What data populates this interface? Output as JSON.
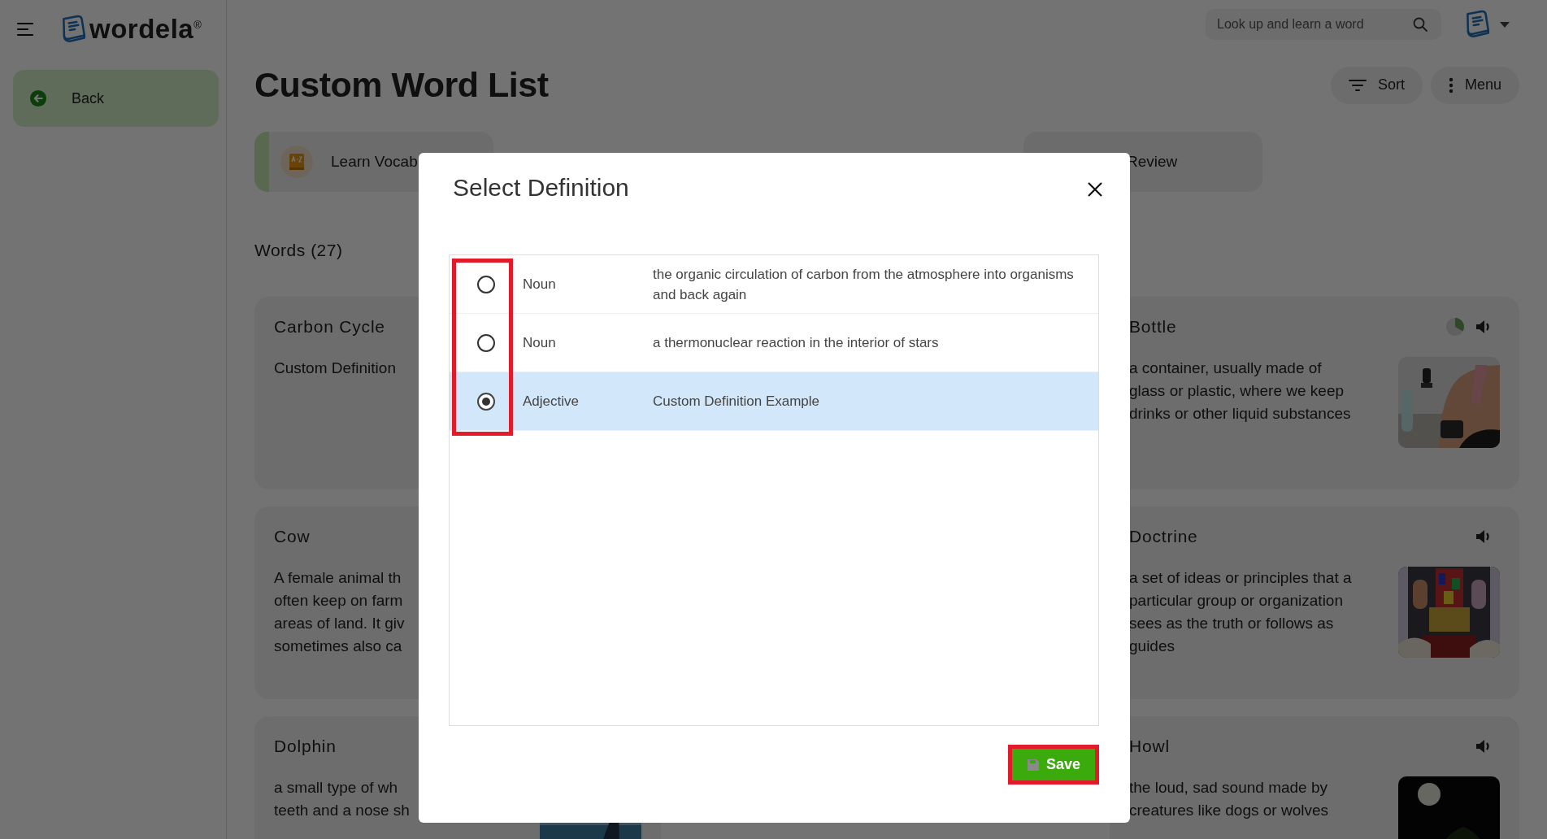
{
  "header": {
    "logo": "wordela$^{®}$",
    "search": {
      "placeholder": "Look up and learn a word"
    }
  },
  "sidebar": {
    "back_button": "Back"
  },
  "page": {
    "title": "Custom Word List",
    "actions": [
      {
        "label": "Sort",
        "kind": "sort"
      },
      {
        "label": "Menu",
        "kind": "menu"
      }
    ]
  },
  "tabs": [
    {
      "label": "Learn Vocab",
      "selected": true
    },
    {
      "label": "Review",
      "selected": false
    }
  ],
  "words_heading": "Words (27)",
  "word_cards": [
    {
      "title": "Carbon Cycle",
      "lines": [
        "Custom Definition"
      ]
    },
    {
      "title": "Bottle",
      "lines": [
        "a container, usually made of",
        "glass or plastic, where we keep",
        "drinks or other liquid substances"
      ],
      "picture": true,
      "speaker": true,
      "progress_pie": true
    },
    {
      "title": "Cow",
      "lines": [
        "A female animal th",
        "often keep on farm",
        "areas of land. It giv",
        "sometimes also ca"
      ]
    },
    {
      "title": "Doctrine",
      "lines": [
        "a set of ideas or principles that a",
        "particular group or organization",
        "sees as the truth or follows as",
        "guides"
      ],
      "picture": true,
      "speaker": true
    },
    {
      "title": "Dolphin",
      "lines": [
        "a small type of wh",
        "teeth and a nose sh"
      ],
      "picture": true
    },
    {
      "title": "Howl",
      "lines": [
        "the loud, sad sound made by",
        "creatures like dogs or wolves"
      ],
      "picture": true,
      "speaker": true
    }
  ],
  "dialog": {
    "title": "Select Definition",
    "radio_column_highlighted": true,
    "definitions": [
      {
        "part_of_speech": "Noun",
        "definition": "the organic circulation of carbon from the atmosphere into organisms and back again",
        "selected": false
      },
      {
        "part_of_speech": "Noun",
        "definition": "a thermonuclear reaction in the interior of stars",
        "selected": false
      },
      {
        "part_of_speech": "Adjective",
        "definition": "Custom Definition Example",
        "selected": true
      }
    ],
    "save_button": {
      "label": "Save",
      "highlighted": true
    }
  }
}
